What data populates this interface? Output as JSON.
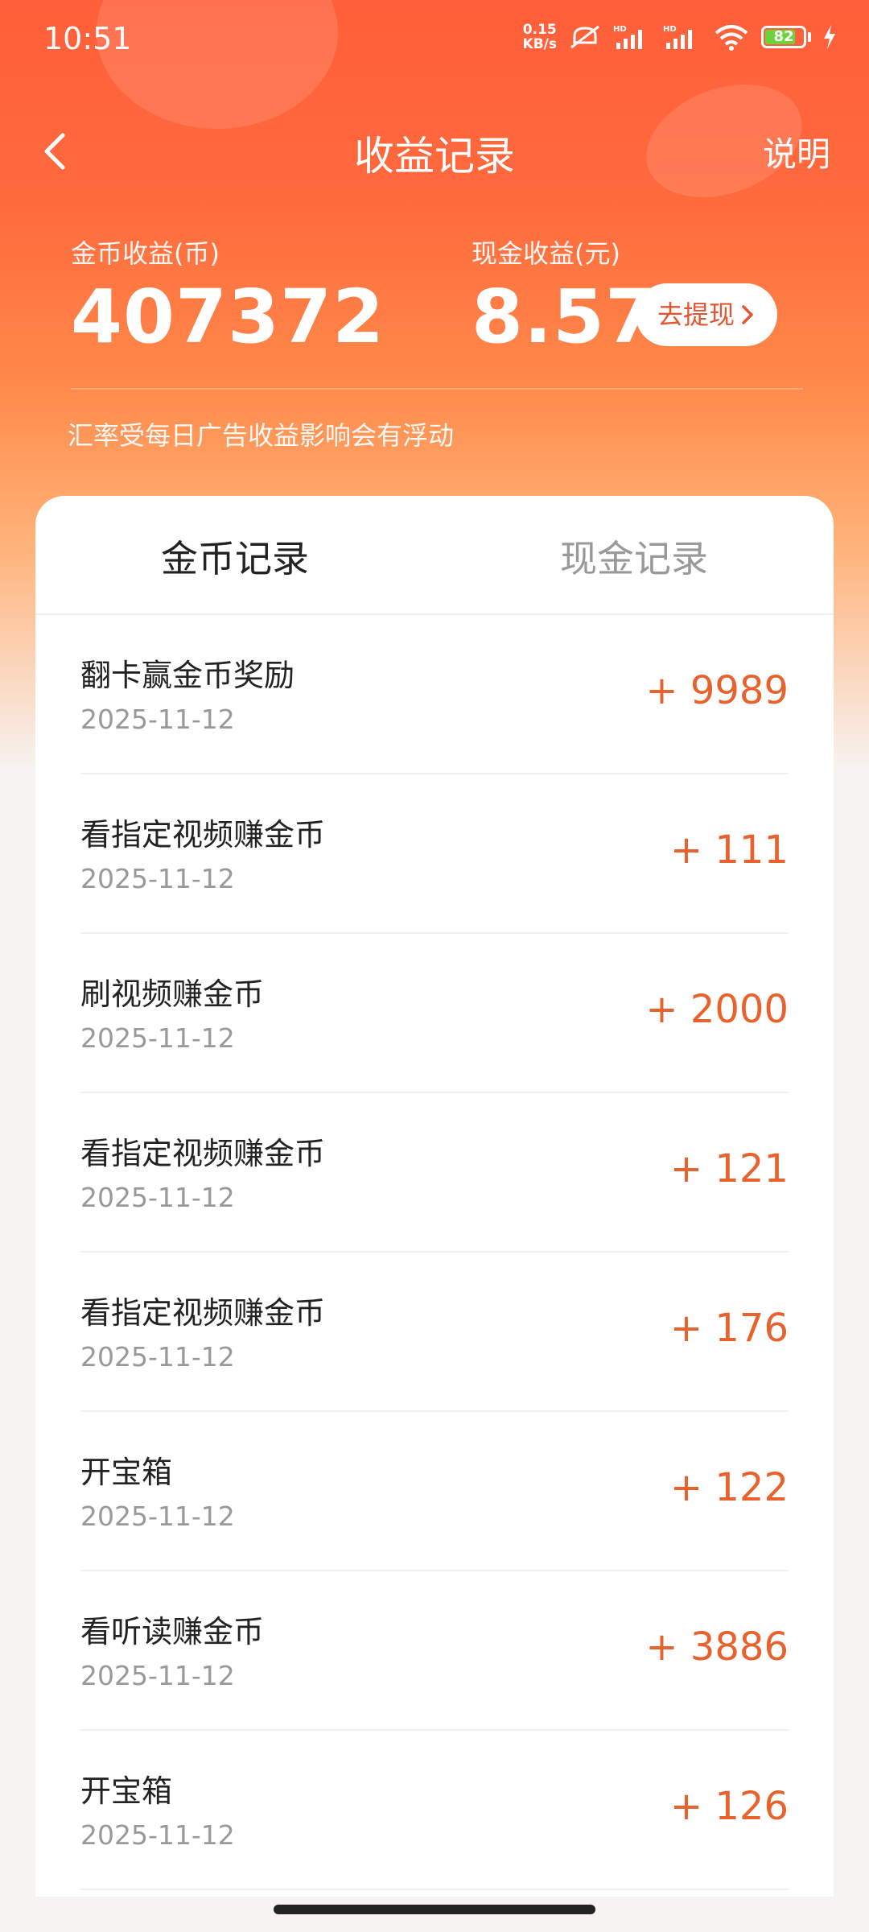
{
  "status_bar": {
    "time": "10:51",
    "net_speed_value": "0.15",
    "net_speed_unit": "KB/s",
    "battery": "82",
    "battery_level": 0.82,
    "accent_battery": "#6ad43a"
  },
  "header": {
    "title": "收益记录",
    "help_label": "说明"
  },
  "summary": {
    "coin_label": "金币收益(币)",
    "coin_value": "407372",
    "cash_label": "现金收益(元)",
    "cash_value": "8.57",
    "withdraw_label": "去提现",
    "rate_note": "汇率受每日广告收益影响会有浮动"
  },
  "tabs": [
    {
      "label": "金币记录",
      "active": true
    },
    {
      "label": "现金记录",
      "active": false
    }
  ],
  "records": [
    {
      "title": "翻卡赢金币奖励",
      "date": "2025-11-12",
      "amount": "+ 9989"
    },
    {
      "title": "看指定视频赚金币",
      "date": "2025-11-12",
      "amount": "+ 111"
    },
    {
      "title": "刷视频赚金币",
      "date": "2025-11-12",
      "amount": "+ 2000"
    },
    {
      "title": "看指定视频赚金币",
      "date": "2025-11-12",
      "amount": "+ 121"
    },
    {
      "title": "看指定视频赚金币",
      "date": "2025-11-12",
      "amount": "+ 176"
    },
    {
      "title": "开宝箱",
      "date": "2025-11-12",
      "amount": "+ 122"
    },
    {
      "title": "看听读赚金币",
      "date": "2025-11-12",
      "amount": "+ 3886"
    },
    {
      "title": "开宝箱",
      "date": "2025-11-12",
      "amount": "+ 126"
    }
  ],
  "colors": {
    "brand": "#ff5f3a",
    "amount": "#e8622e"
  }
}
